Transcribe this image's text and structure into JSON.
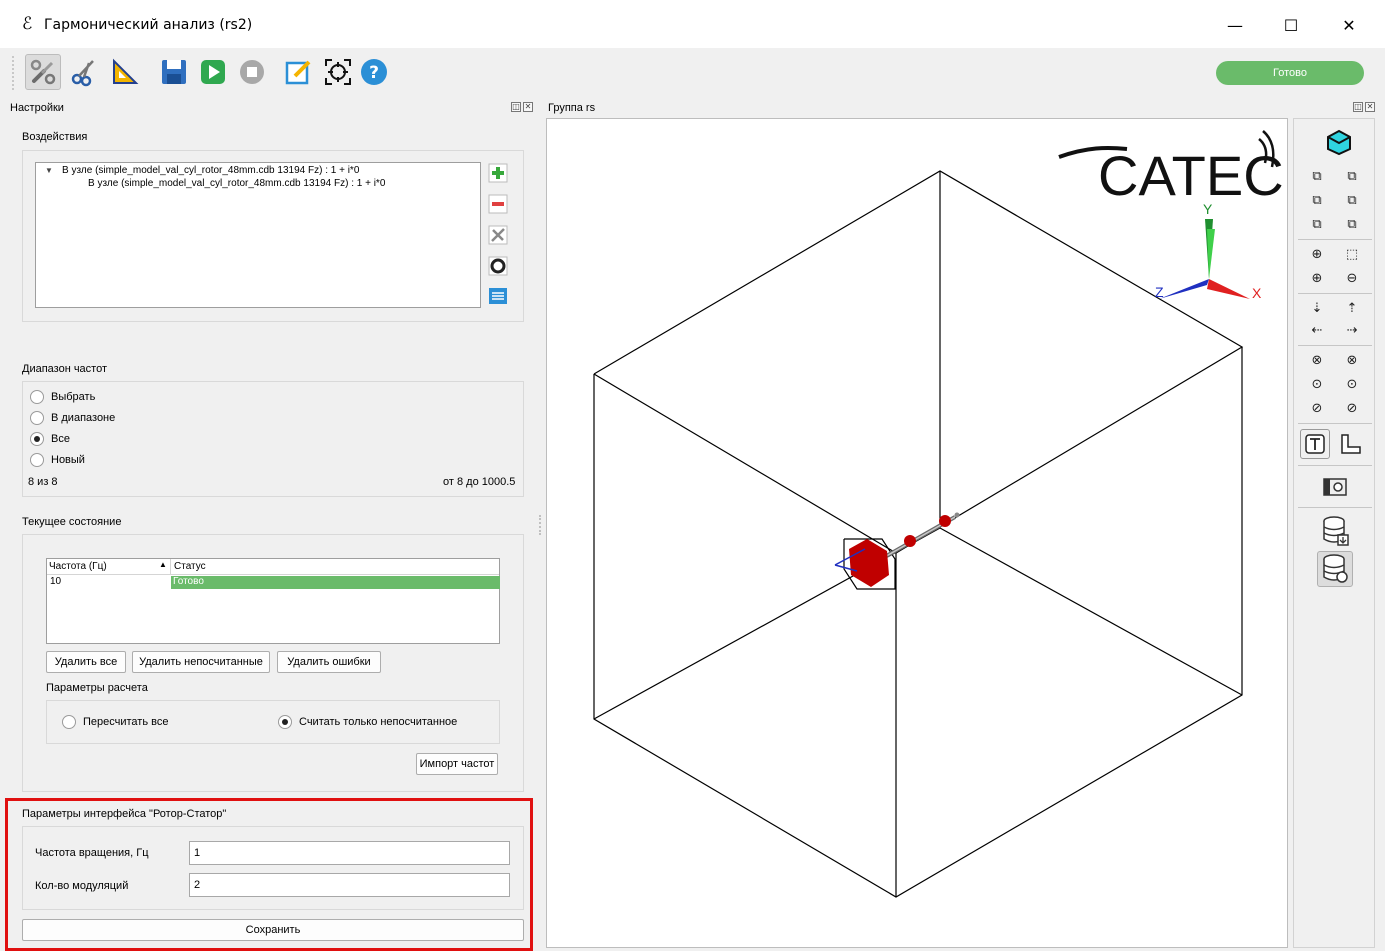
{
  "window": {
    "title": "Гармонический анализ (rs2)",
    "min_glyph": "—",
    "max_glyph": "☐",
    "close_glyph": "✕"
  },
  "toolbar": {
    "status": "Готово",
    "buttons": [
      "settings-icon",
      "cut-icon",
      "triangle-ruler-icon",
      "save-icon",
      "play-icon",
      "stop-icon",
      "edit-icon",
      "select-frame-icon",
      "help-icon"
    ]
  },
  "left_dock": {
    "title": "Настройки",
    "actions": {
      "title": "Воздействия",
      "items": [
        "В узле (simple_model_val_cyl_rotor_48mm.cdb 13194 Fz) : 1 + i*0",
        "В узле (simple_model_val_cyl_rotor_48mm.cdb 13194 Fz) : 1 + i*0"
      ]
    },
    "freq_range": {
      "title": "Диапазон частот",
      "options": [
        "Выбрать",
        "В диапазоне",
        "Все",
        "Новый"
      ],
      "selected": "Все",
      "count": "8 из 8",
      "range": "от 8 до 1000.5"
    },
    "current_state": {
      "title": "Текущее состояние",
      "columns": [
        "Частота (Гц)",
        "Статус"
      ],
      "rows": [
        {
          "freq": "10",
          "status": "Готово"
        }
      ],
      "buttons": {
        "delete_all": "Удалить все",
        "delete_uncomputed": "Удалить непосчитанные",
        "delete_errors": "Удалить ошибки"
      },
      "calc_params_title": "Параметры расчета",
      "calc_options": [
        "Пересчитать все",
        "Считать только непосчитанное"
      ],
      "calc_selected": "Считать только непосчитанное",
      "import_button": "Импорт частот"
    },
    "rotor_stator": {
      "title": "Параметры интерфейса \"Ротор-Статор\"",
      "rotation_label": "Частота вращения, Гц",
      "rotation_value": "1",
      "modulations_label": "Кол-во модуляций",
      "modulations_value": "2",
      "save_button": "Сохранить"
    }
  },
  "right_dock": {
    "title": "Группа rs",
    "logo_text": "CATEC",
    "axis_labels": {
      "x": "X",
      "y": "Y",
      "z": "Z"
    },
    "colors": {
      "x": "#e02020",
      "y": "#20b020",
      "z": "#2030c0",
      "model": "#c00000",
      "accent": "#6abb6a"
    }
  }
}
